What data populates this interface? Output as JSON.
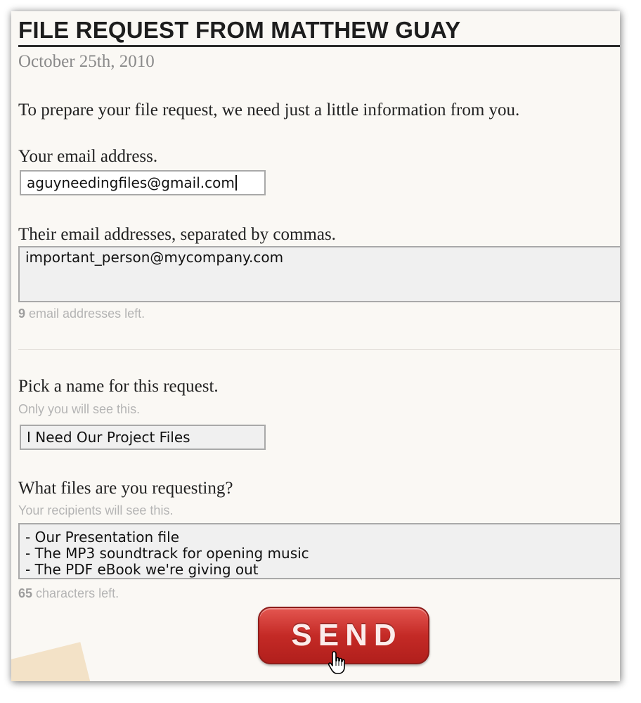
{
  "page": {
    "title": "FILE REQUEST FROM MATTHEW GUAY",
    "date": "October 25th, 2010",
    "intro": "To prepare your file request, we need just a little information from you."
  },
  "your_email": {
    "label": "Your email address.",
    "value": "aguyneedingfiles@gmail.com"
  },
  "their_emails": {
    "label": "Their email addresses, separated by commas.",
    "value": "important_person@mycompany.com",
    "remaining_count": "9",
    "remaining_text": " email addresses left."
  },
  "request_name": {
    "label": "Pick a name for this request.",
    "hint": "Only you will see this.",
    "value": "I Need Our Project Files"
  },
  "files_requested": {
    "label": "What files are you requesting?",
    "hint": "Your recipients will see this.",
    "value": "- Our Presentation file\n- The MP3 soundtrack for opening music\n- The PDF eBook we're giving out",
    "remaining_count": "65",
    "remaining_text": " characters left."
  },
  "send_button": {
    "label": "SEND",
    "color": "#c42a26"
  },
  "icons": {
    "cursor": "hand-pointer-icon"
  }
}
